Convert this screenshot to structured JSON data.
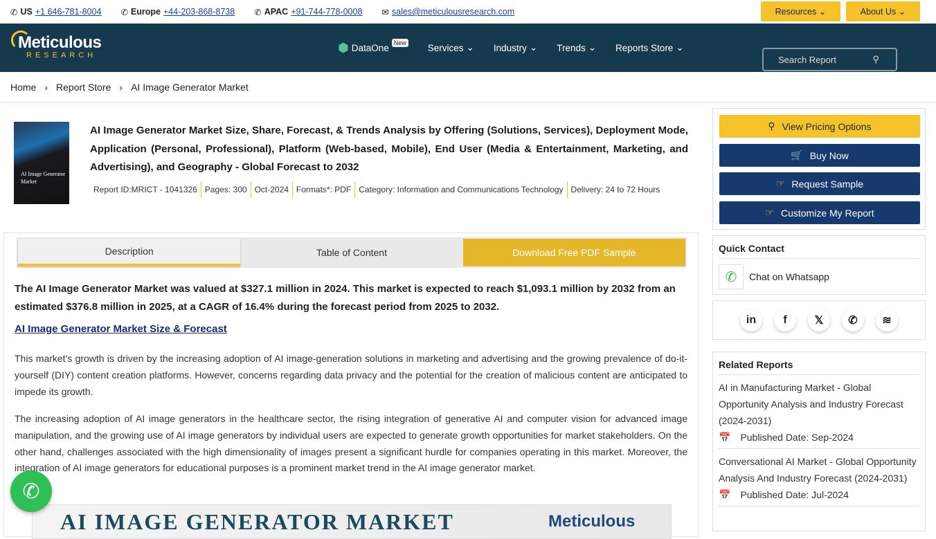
{
  "topbar": {
    "us_label": "US",
    "us_phone": "+1 646-781-8004",
    "eu_label": "Europe",
    "eu_phone": "+44-203-868-8738",
    "apac_label": "APAC",
    "apac_phone": "+91-744-778-0008",
    "email": "sales@meticulousresearch.com",
    "resources": "Resources",
    "about": "About Us"
  },
  "nav": {
    "logo_main": "Meticulous",
    "logo_sub": "RESEARCH",
    "dataone": "DataOne",
    "new_badge": "New",
    "services": "Services",
    "industry": "Industry",
    "trends": "Trends",
    "reports_store": "Reports Store",
    "search_placeholder": "Search Report"
  },
  "breadcrumb": [
    "Home",
    "Report Store",
    "AI Image Generator Market"
  ],
  "report": {
    "cover_text": "AI Image Generator Market",
    "title": "AI Image Generator Market Size, Share, Forecast, & Trends Analysis by Offering (Solutions, Services), Deployment Mode, Application (Personal, Professional), Platform (Web-based, Mobile), End User (Media & Entertainment, Marketing, and Advertising), and Geography - Global Forecast to 2032",
    "meta": [
      "Report ID:MRICT - 1041326",
      "Pages: 300",
      "Oct-2024",
      "Formats*: PDF",
      "Category: Information and Communications Technology",
      "Delivery: 24 to 72 Hours"
    ]
  },
  "tabs": [
    "Description",
    "Table of Content",
    "Download Free PDF Sample"
  ],
  "content": {
    "lead": "The AI Image Generator Market was valued at $327.1 million in 2024. This market is expected to reach $1,093.1 million by 2032 from an estimated $376.8 million in 2025, at a CAGR of 16.4% during the forecast period from 2025 to 2032.",
    "heading": "AI Image Generator Market Size & Forecast",
    "p1": "This market's growth is driven by the increasing adoption of AI image-generation solutions in marketing and advertising and the growing prevalence of do-it-yourself (DIY) content creation platforms. However, concerns regarding data privacy and the potential for the creation of malicious content are anticipated to impede its growth.",
    "p2": "The increasing adoption of AI image generators in the healthcare sector, the rising integration of generative AI and computer vision for advanced image manipulation, and the growing use of AI image generators by individual users are expected to generate growth opportunities for market stakeholders. On the other hand, challenges associated with the high dimensionality of images present a significant hurdle for companies operating in this market. Moreover, the integration of AI image generators for educational purposes is a prominent market trend in the AI image generator market.",
    "banner_title": "AI IMAGE GENERATOR MARKET",
    "banner_logo": "Meticulous"
  },
  "sidebar": {
    "view_pricing": "View Pricing Options",
    "buy_now": "Buy Now",
    "request_sample": "Request Sample",
    "customize": "Customize My Report",
    "quick_contact": "Quick Contact",
    "chat": "Chat on Whatsapp",
    "related_title": "Related Reports",
    "related": [
      {
        "title": "AI in Manufacturing Market - Global Opportunity Analysis and Industry Forecast (2024-2031)",
        "date": "Published Date: Sep-2024"
      },
      {
        "title": "Conversational AI Market - Global Opportunity Analysis And Industry Forecast (2024-2031)",
        "date": "Published Date: Jul-2024"
      }
    ]
  }
}
